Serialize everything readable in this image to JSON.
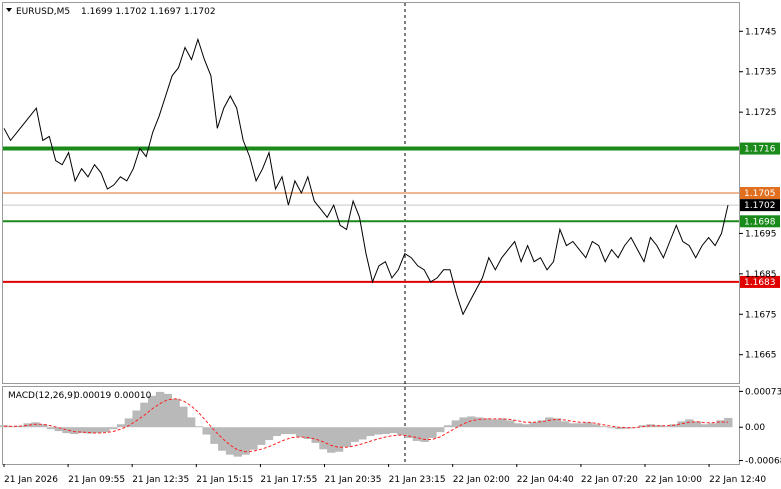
{
  "header": {
    "symbol": "EURUSD,M5",
    "ohlc": "1.1699 1.1702 1.1697 1.1702"
  },
  "macd_header": {
    "label": "MACD(12,26,9)",
    "values": "0.00019 0.00010"
  },
  "colors": {
    "background": "#ffffff",
    "grid": "#c0c0c0",
    "price_line": "#000000",
    "green": "#1a8a1a",
    "orange": "#e07020",
    "red": "#e00000",
    "macd_hist": "#b9b9b9",
    "macd_signal": "#ff2020",
    "current_tag": "#000000"
  },
  "chart_data": [
    {
      "type": "line",
      "series_name": "EURUSD,M5",
      "ylim": [
        1.1658,
        1.1752
      ],
      "price_ticks": [
        "1.1745",
        "1.1735",
        "1.1725",
        "1.1695",
        "1.1685",
        "1.1675",
        "1.1665"
      ],
      "x_labels": [
        "21 Jan 2026",
        "21 Jan 09:55",
        "21 Jan 12:35",
        "21 Jan 15:15",
        "21 Jan 17:55",
        "21 Jan 20:35",
        "21 Jan 23:15",
        "22 Jan 02:00",
        "22 Jan 04:40",
        "22 Jan 07:20",
        "22 Jan 10:00",
        "22 Jan 12:40"
      ],
      "levels": [
        {
          "label": "1.1716",
          "value": 1.1716,
          "color": "#1a8a1a",
          "kind": "green-thick"
        },
        {
          "label": "1.1705",
          "value": 1.1705,
          "color": "#e07020",
          "kind": "orange"
        },
        {
          "label": "1.1698",
          "value": 1.1698,
          "color": "#1a8a1a",
          "kind": "green"
        },
        {
          "label": "1.1683",
          "value": 1.1683,
          "color": "#e00000",
          "kind": "red"
        }
      ],
      "current": {
        "label": "1.1702",
        "value": 1.1702
      },
      "points": [
        1.1721,
        1.1718,
        1.172,
        1.1722,
        1.1724,
        1.1726,
        1.1718,
        1.1719,
        1.1713,
        1.1712,
        1.1715,
        1.1708,
        1.1711,
        1.1709,
        1.1712,
        1.171,
        1.1706,
        1.1707,
        1.1709,
        1.1708,
        1.1711,
        1.1716,
        1.1714,
        1.172,
        1.1724,
        1.1729,
        1.1734,
        1.1736,
        1.1741,
        1.1738,
        1.1743,
        1.1738,
        1.1734,
        1.1721,
        1.1726,
        1.1729,
        1.1726,
        1.1718,
        1.1714,
        1.1708,
        1.1711,
        1.1715,
        1.1706,
        1.1709,
        1.1702,
        1.1708,
        1.1705,
        1.1709,
        1.1703,
        1.1701,
        1.1699,
        1.1702,
        1.1697,
        1.1696,
        1.1703,
        1.1699,
        1.169,
        1.1683,
        1.1687,
        1.1688,
        1.1684,
        1.1686,
        1.169,
        1.1689,
        1.1687,
        1.1686,
        1.1683,
        1.1684,
        1.1686,
        1.1686,
        1.168,
        1.1675,
        1.1678,
        1.1681,
        1.1684,
        1.1689,
        1.1686,
        1.1689,
        1.1691,
        1.1693,
        1.1688,
        1.1692,
        1.1688,
        1.1689,
        1.1686,
        1.1688,
        1.1696,
        1.1692,
        1.1693,
        1.1691,
        1.1689,
        1.1693,
        1.1692,
        1.1688,
        1.1691,
        1.1689,
        1.1692,
        1.1694,
        1.1691,
        1.1688,
        1.1694,
        1.1692,
        1.1689,
        1.1693,
        1.1697,
        1.1693,
        1.1692,
        1.1689,
        1.1692,
        1.1694,
        1.1692,
        1.1695,
        1.1702
      ],
      "x_start": "21 Jan 2026",
      "x_end": "22 Jan 12:40"
    },
    {
      "type": "bar",
      "series_name": "MACD(12,26,9)",
      "ylim": [
        -0.00075,
        0.00082
      ],
      "y_ticks": [
        "0.00073",
        "0.00",
        "-0.00068"
      ],
      "macd_values": [
        4e-05,
        2e-05,
        3e-05,
        8e-05,
        0.0001,
        6e-05,
        -4e-05,
        -8e-05,
        -0.00012,
        -0.00014,
        -0.00012,
        -0.00013,
        -0.00012,
        -0.0001,
        -4e-05,
        6e-05,
        0.00018,
        0.00034,
        0.0005,
        0.00064,
        0.00072,
        0.00068,
        0.00058,
        0.00042,
        0.0002,
        2e-05,
        -0.00015,
        -0.00034,
        -0.00048,
        -0.00056,
        -0.0006,
        -0.00056,
        -0.00046,
        -0.00036,
        -0.00026,
        -0.00018,
        -0.00014,
        -0.00014,
        -0.0002,
        -0.00024,
        -0.00032,
        -0.00045,
        -0.00052,
        -0.0005,
        -0.0004,
        -0.0003,
        -0.00025,
        -0.00018,
        -0.00015,
        -0.00014,
        -0.00012,
        -0.00016,
        -0.00022,
        -0.00028,
        -0.0003,
        -0.00022,
        -0.0001,
        4e-05,
        0.00014,
        0.0002,
        0.00022,
        0.0002,
        0.00018,
        0.00016,
        0.00018,
        0.00014,
        8e-05,
        6e-05,
        0.0001,
        0.00014,
        0.0002,
        0.00018,
        0.00012,
        8e-05,
        8e-05,
        0.0001,
        6e-05,
        2e-05,
        -2e-05,
        -4e-05,
        -3e-05,
        0.0,
        4e-05,
        6e-05,
        4e-05,
        2e-05,
        6e-05,
        0.00012,
        0.00016,
        0.00012,
        6e-05,
        8e-05,
        0.00014,
        0.00019
      ],
      "signal_values": [
        2e-05,
        2e-05,
        2e-05,
        4e-05,
        6e-05,
        6e-05,
        3e-05,
        -1e-05,
        -5e-05,
        -9e-05,
        -0.0001,
        -0.00011,
        -0.00012,
        -0.00011,
        -9e-05,
        -4e-05,
        3e-05,
        0.00013,
        0.00024,
        0.00037,
        0.00048,
        0.00056,
        0.00058,
        0.00054,
        0.00044,
        0.0003,
        0.00012,
        -6e-05,
        -0.00022,
        -0.00036,
        -0.00046,
        -0.0005,
        -0.00049,
        -0.00045,
        -0.0004,
        -0.00033,
        -0.00026,
        -0.00021,
        -0.0002,
        -0.00021,
        -0.00024,
        -0.0003,
        -0.00037,
        -0.00041,
        -0.00041,
        -0.00038,
        -0.00034,
        -0.00029,
        -0.00024,
        -0.0002,
        -0.00017,
        -0.00016,
        -0.00018,
        -0.00021,
        -0.00025,
        -0.00025,
        -0.0002,
        -0.00011,
        -2e-05,
        7e-05,
        0.00013,
        0.00016,
        0.00017,
        0.00017,
        0.00017,
        0.00016,
        0.00013,
        0.0001,
        0.0001,
        0.00011,
        0.00014,
        0.00016,
        0.00015,
        0.00012,
        0.0001,
        0.0001,
        8e-05,
        5e-05,
        2e-05,
        0.0,
        -1e-05,
        -1e-05,
        1e-05,
        3e-05,
        3e-05,
        3e-05,
        4e-05,
        7e-05,
        0.0001,
        0.00011,
        9e-05,
        9e-05,
        0.00011,
        0.0001
      ]
    }
  ]
}
